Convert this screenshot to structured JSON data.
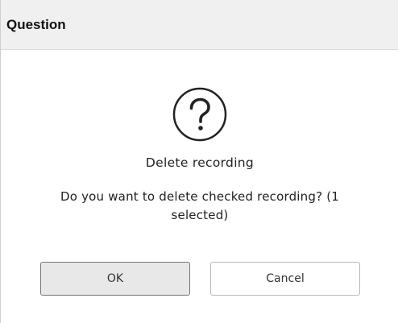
{
  "dialog": {
    "title": "Question",
    "icon": "question-circle-icon",
    "heading": "Delete recording",
    "message": "Do you want to delete checked recording? (1 selected)",
    "buttons": {
      "ok_label": "OK",
      "cancel_label": "Cancel"
    }
  },
  "colors": {
    "titlebar_bg": "#f0f0f0",
    "ok_button_bg": "#e8e8e8",
    "text": "#222222"
  }
}
